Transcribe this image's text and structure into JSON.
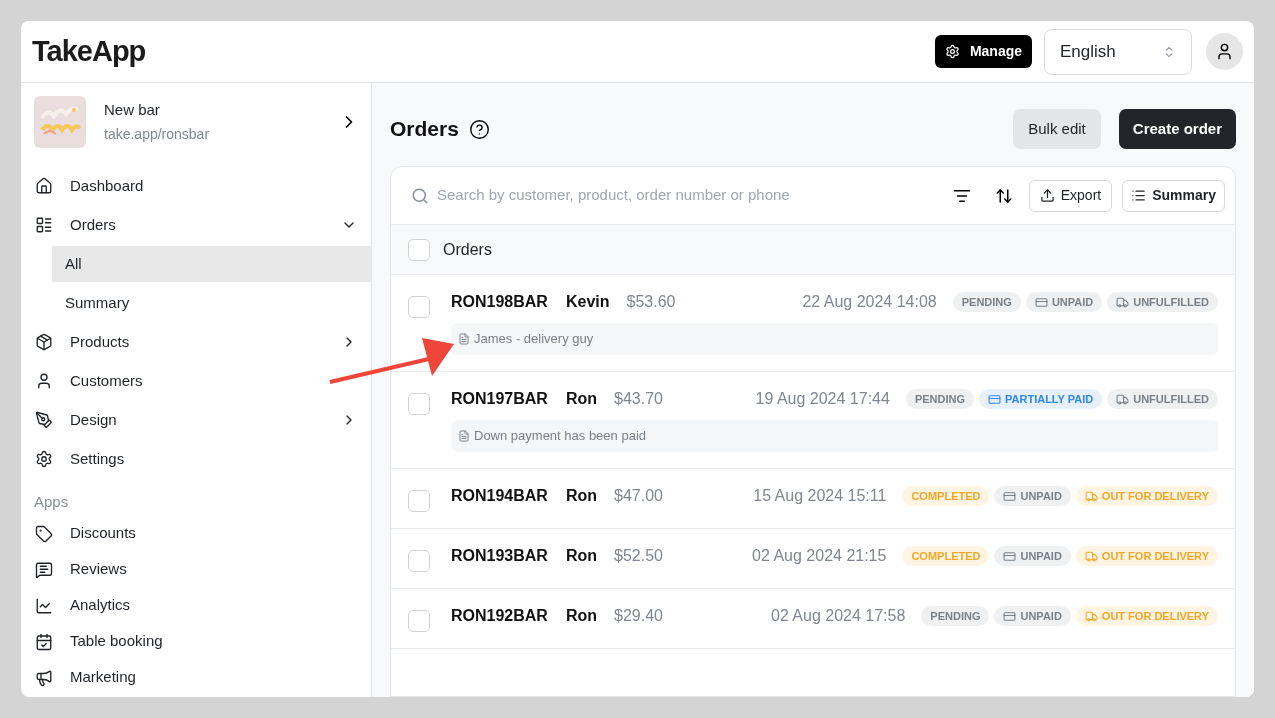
{
  "header": {
    "logo": "TakeApp",
    "manage_button": "Manage",
    "language_select": {
      "value": "English"
    }
  },
  "sidebar": {
    "store": {
      "name": "New bar",
      "url": "take.app/ronsbar"
    },
    "nav": [
      {
        "label": "Dashboard",
        "selected": false
      },
      {
        "label": "Orders",
        "selected": false,
        "expanded": true,
        "children": [
          {
            "label": "All",
            "selected": true
          },
          {
            "label": "Summary",
            "selected": false
          }
        ]
      },
      {
        "label": "Products",
        "selected": false,
        "expanded": false
      },
      {
        "label": "Customers",
        "selected": false
      },
      {
        "label": "Design",
        "selected": false,
        "expanded": false
      },
      {
        "label": "Settings",
        "selected": false
      }
    ],
    "section_label": "Apps",
    "apps": [
      {
        "label": "Discounts",
        "selected": false
      },
      {
        "label": "Reviews",
        "selected": false
      },
      {
        "label": "Analytics",
        "selected": false
      },
      {
        "label": "Table booking",
        "selected": false
      },
      {
        "label": "Marketing",
        "selected": false
      }
    ]
  },
  "main": {
    "title": "Orders",
    "bulk_edit_button": "Bulk edit",
    "create_order_button": "Create order",
    "search": {
      "placeholder": "Search by customer, product, order number or phone"
    },
    "export_button": "Export",
    "summary_button": "Summary",
    "list_header": {
      "label": "Orders",
      "checked": false
    },
    "orders": [
      {
        "number": "RON198BAR",
        "customer": "Kevin",
        "total": "$53.60",
        "date": "22 Aug 2024 14:08",
        "checked": false,
        "note": "James - delivery guy",
        "badges": [
          {
            "kind": "status",
            "label": "PENDING",
            "color": "#7a808a"
          },
          {
            "kind": "payment",
            "label": "UNPAID",
            "color": "#7a808a"
          },
          {
            "kind": "fulfillment",
            "label": "UNFULFILLED",
            "color": "#7a808a"
          }
        ]
      },
      {
        "number": "RON197BAR",
        "customer": "Ron",
        "total": "$43.70",
        "date": "19 Aug 2024 17:44",
        "checked": false,
        "note": "Down payment has been paid",
        "badges": [
          {
            "kind": "status",
            "label": "PENDING",
            "color": "#7a808a"
          },
          {
            "kind": "payment",
            "label": "PARTIALLY PAID",
            "color": "#2f86eb"
          },
          {
            "kind": "fulfillment",
            "label": "UNFULFILLED",
            "color": "#7a808a"
          }
        ]
      },
      {
        "number": "RON194BAR",
        "customer": "Ron",
        "total": "$47.00",
        "date": "15 Aug 2024 15:11",
        "checked": false,
        "badges": [
          {
            "kind": "status",
            "label": "COMPLETED",
            "color": "#f5a623"
          },
          {
            "kind": "payment",
            "label": "UNPAID",
            "color": "#7a808a"
          },
          {
            "kind": "fulfillment",
            "label": "OUT FOR DELIVERY",
            "color": "#f5a623"
          }
        ]
      },
      {
        "number": "RON193BAR",
        "customer": "Ron",
        "total": "$52.50",
        "date": "02 Aug 2024 21:15",
        "checked": false,
        "badges": [
          {
            "kind": "status",
            "label": "COMPLETED",
            "color": "#f5a623"
          },
          {
            "kind": "payment",
            "label": "UNPAID",
            "color": "#7a808a"
          },
          {
            "kind": "fulfillment",
            "label": "OUT FOR DELIVERY",
            "color": "#f5a623"
          }
        ]
      },
      {
        "number": "RON192BAR",
        "customer": "Ron",
        "total": "$29.40",
        "date": "02 Aug 2024 17:58",
        "checked": false,
        "badges": [
          {
            "kind": "status",
            "label": "PENDING",
            "color": "#7a808a"
          },
          {
            "kind": "payment",
            "label": "UNPAID",
            "color": "#7a808a"
          },
          {
            "kind": "fulfillment",
            "label": "OUT FOR DELIVERY",
            "color": "#f5a623"
          }
        ]
      }
    ]
  }
}
